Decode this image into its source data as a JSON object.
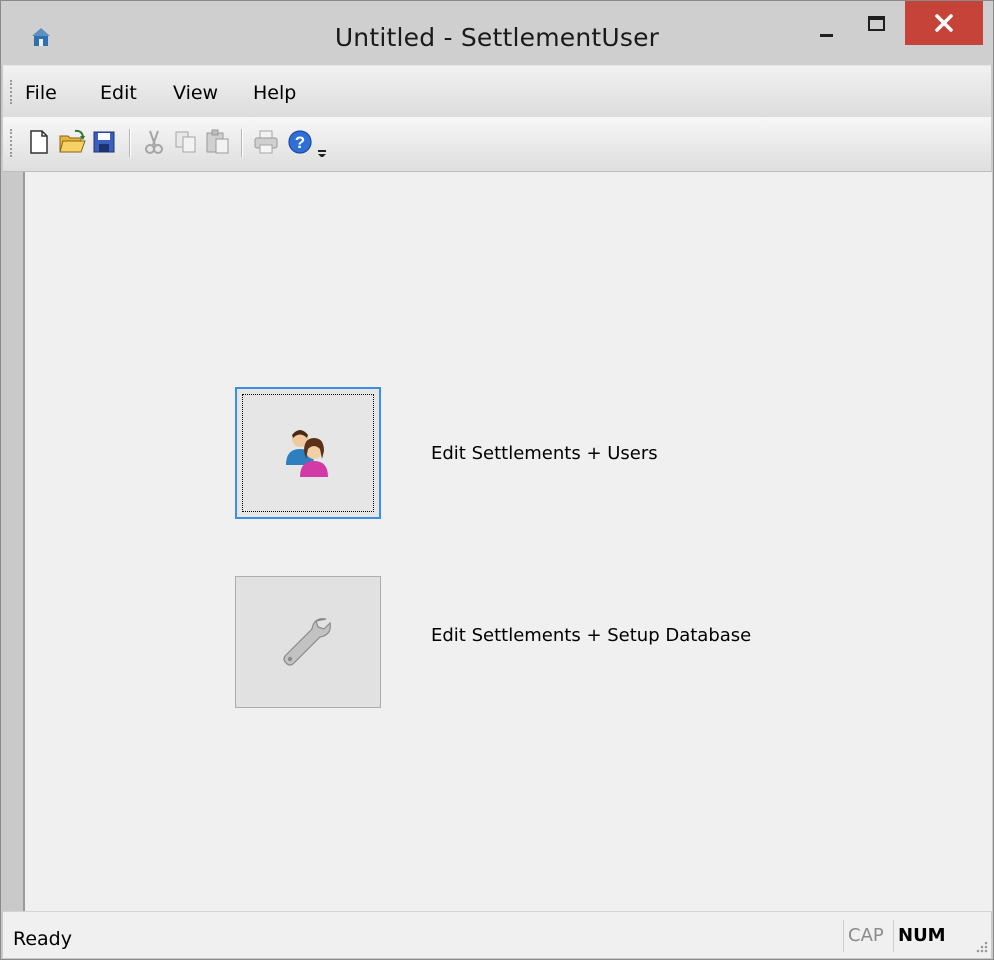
{
  "window": {
    "title": "Untitled - SettlementUser",
    "app_icon": "house-app-icon",
    "controls": [
      "minimize-icon",
      "maximize-icon",
      "close-icon"
    ]
  },
  "menu": {
    "items": [
      {
        "label": "File"
      },
      {
        "label": "Edit"
      },
      {
        "label": "View"
      },
      {
        "label": "Help"
      }
    ]
  },
  "toolbar": {
    "buttons": [
      {
        "icon": "new-document-icon",
        "enabled": true
      },
      {
        "icon": "open-folder-icon",
        "enabled": true
      },
      {
        "icon": "save-icon",
        "enabled": true
      },
      {
        "icon": "cut-icon",
        "enabled": false
      },
      {
        "icon": "copy-icon",
        "enabled": false
      },
      {
        "icon": "paste-icon",
        "enabled": false
      },
      {
        "icon": "print-icon",
        "enabled": false
      },
      {
        "icon": "help-icon",
        "enabled": true
      },
      {
        "icon": "overflow-chevron-icon",
        "enabled": true
      }
    ]
  },
  "main": {
    "actions": [
      {
        "label": "Edit Settlements + Users",
        "icon": "users-icon",
        "enabled": true,
        "focused": true
      },
      {
        "label": "Edit Settlements + Setup Database",
        "icon": "wrench-icon",
        "enabled": false,
        "focused": false
      }
    ]
  },
  "status": {
    "text": "Ready",
    "indicators": [
      {
        "label": "CAP",
        "active": false
      },
      {
        "label": "NUM",
        "active": true
      }
    ]
  },
  "colors": {
    "close_button": "#c6433a",
    "focus_border": "#3c8fe2",
    "client_background": "#f0f0f0",
    "titlebar": "#cfcfcf"
  }
}
